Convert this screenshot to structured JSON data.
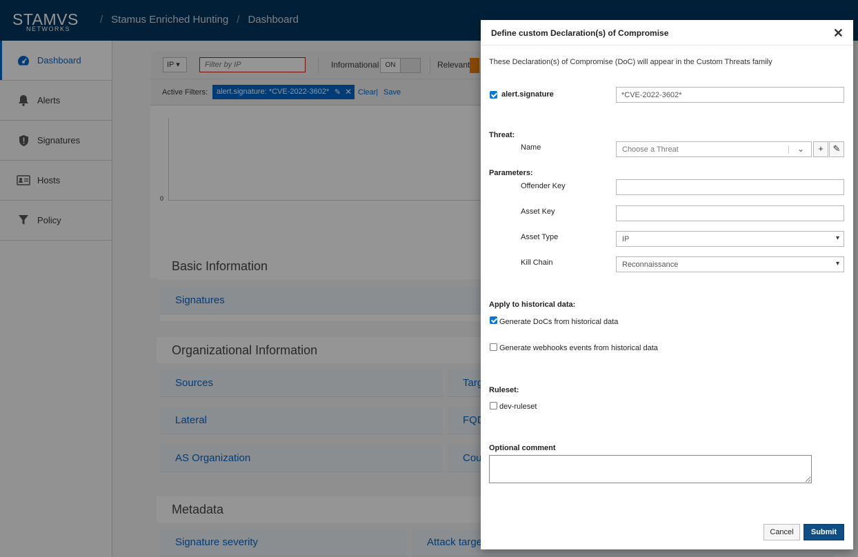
{
  "header": {
    "logo_text": "STAMVS",
    "logo_sub": "NETWORKS",
    "breadcrumbs": [
      "Stamus Enriched Hunting",
      "Dashboard"
    ],
    "separator": "/"
  },
  "sidebar": {
    "items": [
      {
        "label": "Dashboard",
        "icon": "dashboard-icon",
        "active": true
      },
      {
        "label": "Alerts",
        "icon": "bell-icon",
        "active": false
      },
      {
        "label": "Signatures",
        "icon": "shield-icon",
        "active": false
      },
      {
        "label": "Hosts",
        "icon": "id-card-icon",
        "active": false
      },
      {
        "label": "Policy",
        "icon": "filter-icon",
        "active": false
      }
    ]
  },
  "toolbar": {
    "ip_select": "IP",
    "filter_placeholder": "Filter by IP",
    "informational_label": "Informational",
    "informational_toggle": "ON",
    "relevant_label": "Relevant",
    "relevant_tag": "O"
  },
  "filters": {
    "label": "Active Filters:",
    "chip": "alert.signature: *CVE-2022-3602*",
    "clear": "Clear",
    "pipe": "|",
    "save": "Save"
  },
  "chart": {
    "zero_tick": "0"
  },
  "sections": {
    "basic": "Basic Information",
    "organizational": "Organizational Information",
    "metadata": "Metadata"
  },
  "panels": {
    "signatures": "Signatures",
    "sources": "Sources",
    "targets": "Targ",
    "lateral": "Lateral",
    "fqdn": "FQD",
    "as_org": "AS Organization",
    "country": "Cou",
    "sig_severity": "Signature severity",
    "attack_target": "Attack targe"
  },
  "modal": {
    "title": "Define custom Declaration(s) of Compromise",
    "close": "✕",
    "description": "These Declaration(s) of Compromise (DoC) will appear in the Custom Threats family",
    "signature_label": "alert.signature",
    "signature_value": "*CVE-2022-3602*",
    "signature_checked": true,
    "threat_heading": "Threat:",
    "name_label": "Name",
    "threat_placeholder": "Choose a Threat",
    "add_btn": "+",
    "edit_btn": "✎",
    "parameters_heading": "Parameters:",
    "offender_key_label": "Offender Key",
    "offender_key_value": "",
    "asset_key_label": "Asset Key",
    "asset_key_value": "",
    "asset_type_label": "Asset Type",
    "asset_type_value": "IP",
    "kill_chain_label": "Kill Chain",
    "kill_chain_value": "Reconnaissance",
    "historical_heading": "Apply to historical data:",
    "gen_docs_label": "Generate DoCs from historical data",
    "gen_docs_checked": true,
    "gen_webhooks_label": "Generate webhooks events from historical data",
    "gen_webhooks_checked": false,
    "ruleset_heading": "Ruleset:",
    "ruleset_item": "dev-ruleset",
    "ruleset_checked": false,
    "comment_label": "Optional comment",
    "comment_value": "",
    "cancel": "Cancel",
    "submit": "Submit"
  },
  "colors": {
    "header_bg": "#00365f",
    "accent": "#0066cc",
    "submit_bg": "#0f4e85",
    "relevant_orange": "#ec7a08",
    "error_border": "#c9190b"
  }
}
